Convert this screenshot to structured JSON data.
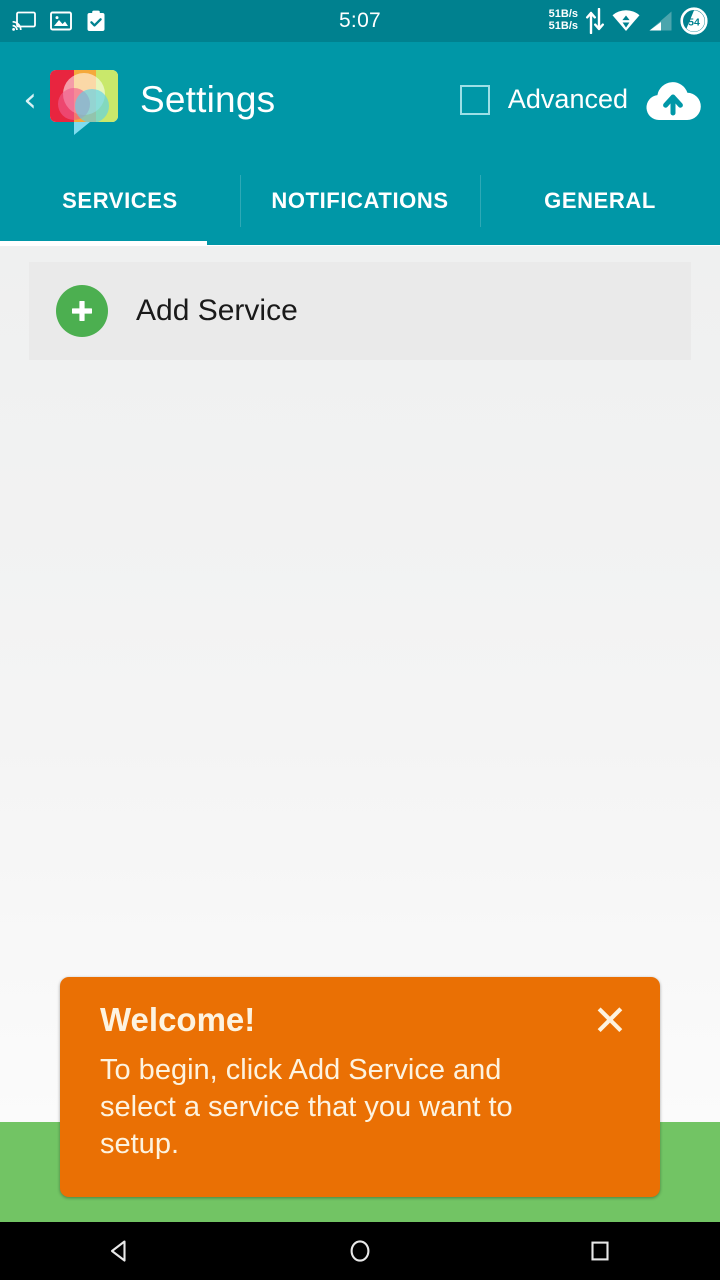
{
  "status_bar": {
    "time": "5:07",
    "icons_left": [
      "cast-icon",
      "image-icon",
      "clipboard-check-icon"
    ],
    "network_speed_up": "51B/s",
    "network_speed_down": "51B/s",
    "icons_right": [
      "data-transfer-icon",
      "wifi-icon",
      "cellular-signal-icon"
    ],
    "battery_level": "54"
  },
  "app_bar": {
    "back_label": "‹",
    "title": "Settings",
    "logo_name": "app-logo-icon",
    "advanced_label": "Advanced",
    "advanced_checked": false,
    "cloud_upload_name": "cloud-upload-icon"
  },
  "tabs": {
    "items": [
      {
        "label": "SERVICES",
        "active": true
      },
      {
        "label": "NOTIFICATIONS",
        "active": false
      },
      {
        "label": "GENERAL",
        "active": false
      }
    ]
  },
  "content": {
    "add_service_label": "Add Service",
    "add_icon_name": "plus-icon"
  },
  "toast": {
    "title": "Welcome!",
    "body": "To begin, click Add Service and select a service that you want to setup.",
    "close_label": "✕"
  },
  "nav_bar": {
    "back": "back-icon",
    "home": "home-icon",
    "recents": "recents-icon"
  },
  "colors": {
    "status_bar": "#00818f",
    "app_bar": "#0097a7",
    "accent_green": "#4caf50",
    "toast_orange": "#ea7004",
    "toast_text": "#fdf3e0",
    "band_green": "#72c464"
  }
}
